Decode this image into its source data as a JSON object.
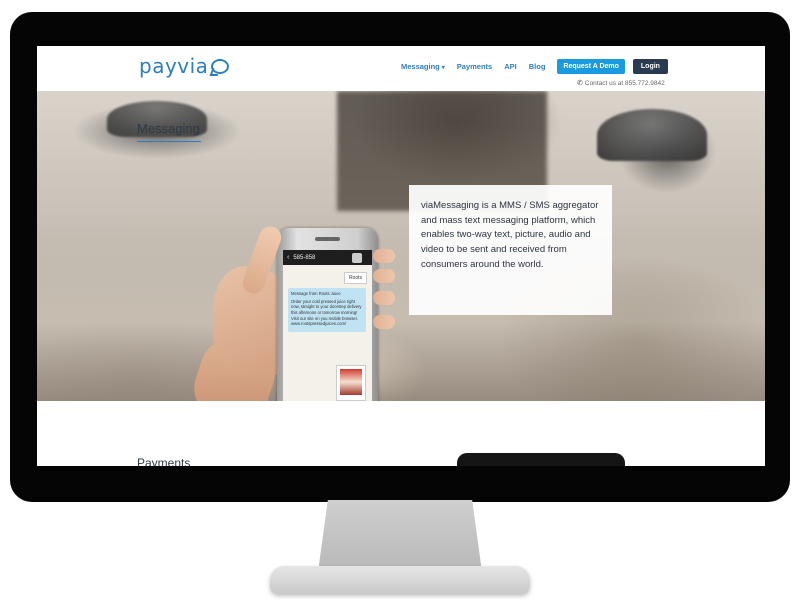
{
  "header": {
    "logo": "payvia",
    "nav": [
      {
        "label": "Messaging",
        "has_caret": true
      },
      {
        "label": "Payments"
      },
      {
        "label": "API"
      },
      {
        "label": "Blog"
      }
    ],
    "request_demo_label": "Request A Demo",
    "login_label": "Login",
    "contact_text": "Contact us at 855.772.9842"
  },
  "hero": {
    "title": "Messaging",
    "description": "viaMessaging is a MMS / SMS aggregator and mass text messaging platform, which enables two-way text, picture, audio and video to be sent and received from consumers around the world.",
    "phone": {
      "contact_number": "585-858",
      "reply_bubble": "Roots",
      "message_lines": [
        "Message from Roots Juice",
        "Order your cold pressed juice right now, straight to your doorstep delivery this afternoon or tomorrow morning! Visit our site on you mobile browser. www.rootspressedjuices.com/"
      ],
      "mms_label": "Roots"
    }
  },
  "section_next": {
    "title": "Payments"
  },
  "colors": {
    "brand_blue": "#2b7fbf",
    "demo_button": "#1a9be0",
    "login_button": "#2a3a4f"
  }
}
